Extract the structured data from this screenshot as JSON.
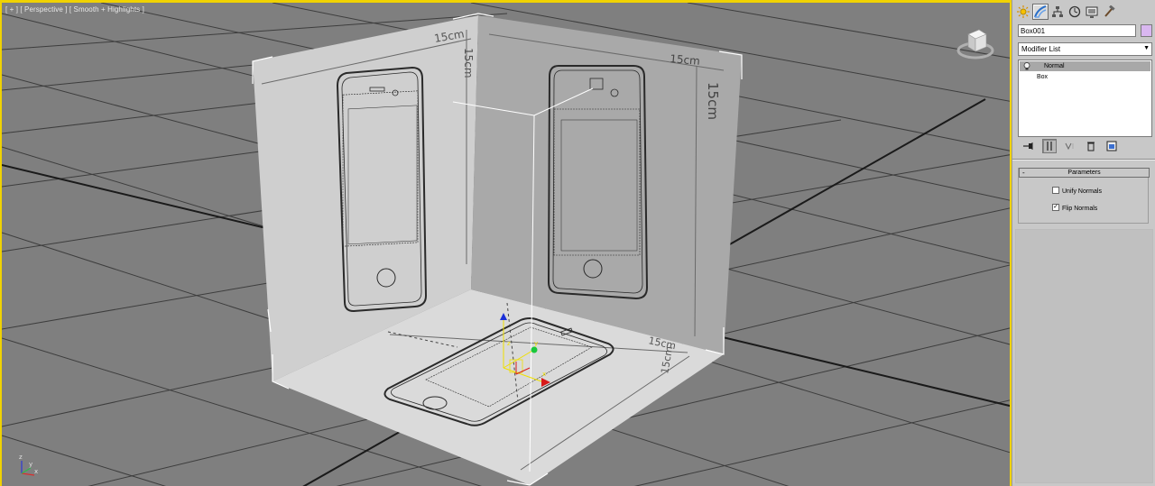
{
  "viewport": {
    "label": "[ + ] [ Perspective ] [ Smooth + Highlights ]",
    "dimensions": {
      "left_wall_width": "15cm",
      "left_wall_height": "15cm",
      "right_wall_width": "15cm",
      "right_wall_height": "15cm",
      "floor_width": "15cm",
      "floor_depth": "15cm"
    },
    "viewcube_icon": "viewcube-icon",
    "axis_labels": {
      "x": "x",
      "y": "y",
      "z": "z"
    }
  },
  "panel": {
    "tabs": [
      "create-icon",
      "modify-icon",
      "hierarchy-icon",
      "motion-icon",
      "display-icon",
      "utilities-icon"
    ],
    "object_name": "Box001",
    "object_color": "#d9b7f0",
    "modifier_list": "Modifier List",
    "stack": [
      {
        "label": "Normal",
        "selected": true
      },
      {
        "label": "Box",
        "selected": false
      }
    ],
    "parameters": {
      "title": "Parameters",
      "collapse": "-",
      "unify_normals": {
        "label": "Unify Normals",
        "checked": false
      },
      "flip_normals": {
        "label": "Flip Normals",
        "checked": true
      }
    }
  },
  "colors": {
    "viewport_bg": "#7f7f7f",
    "active_border": "#f0d200",
    "grid": "#3a3a3a",
    "wall": "#d0d0d0"
  }
}
